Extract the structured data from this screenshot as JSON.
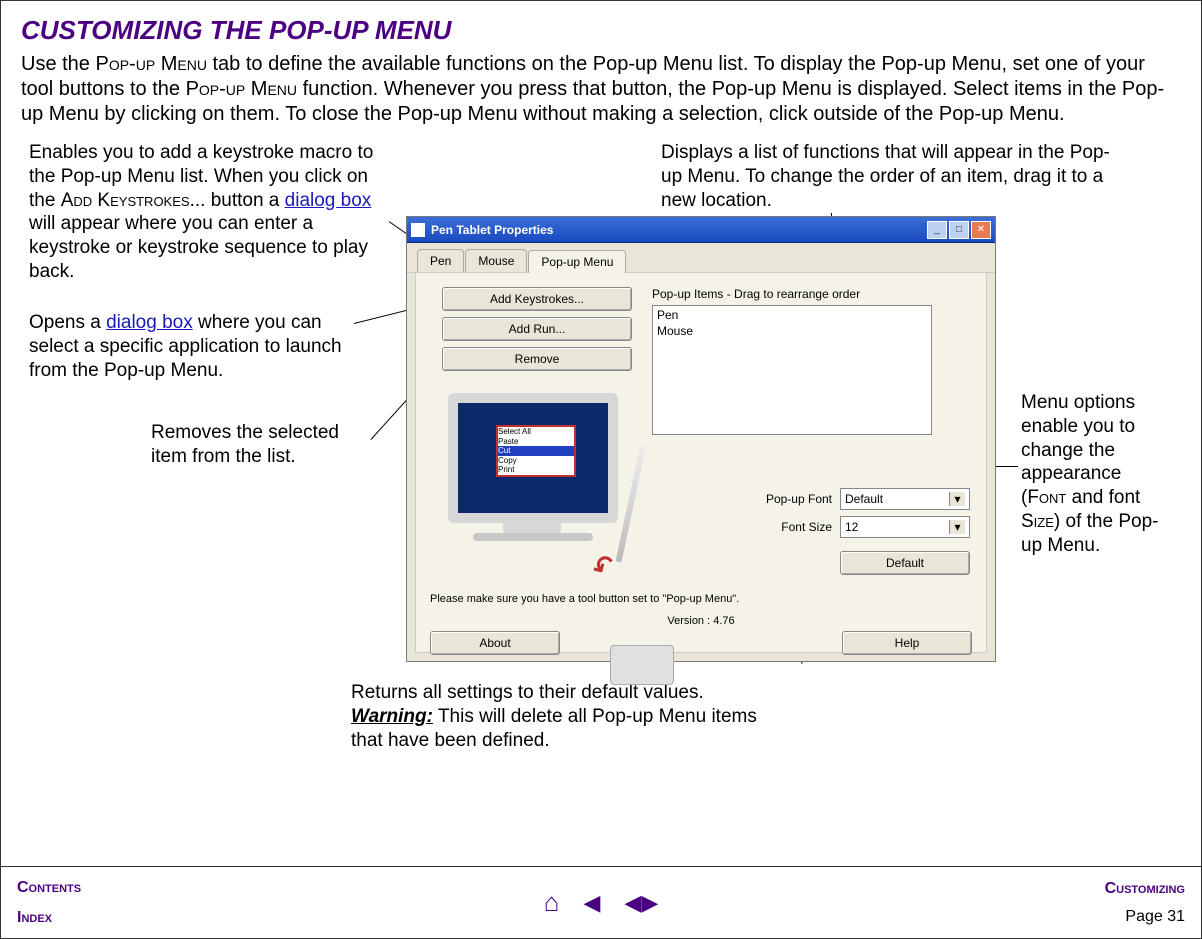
{
  "title": "CUSTOMIZING THE POP-UP MENU",
  "intro": "Use the Pop-up Menu tab to define the available functions on the Pop-up Menu list. To display the Pop-up Menu, set one of your tool buttons to the Pop-up Menu function. Whenever you press that button, the Pop-up Menu is displayed. Select items in the Pop-up Menu by clicking on them. To close the Pop-up Menu without making a selection, click outside of the Pop-up Menu.",
  "callouts": {
    "addKeystrokes": {
      "pre": "Enables you to add a keystroke macro to the Pop-up Menu list. When you click on the ",
      "sc": "Add Keystrokes",
      "mid": "... button a ",
      "link": "dialog box",
      "post": " will appear where you can enter a keystroke or keystroke sequence to play back."
    },
    "addRun": {
      "pre": "Opens a ",
      "link": "dialog box",
      "post": " where you can select a specific application to launch from the Pop-up Menu."
    },
    "remove": "Removes the selected item from the list.",
    "popupItems": "Displays a list of functions that will appear in the Pop-up Menu. To change the order of an item, drag it to a new location.",
    "fontOptions": {
      "pre": "Menu options enable you to change the appearance (",
      "sc1": "Font",
      "mid": " and font ",
      "sc2": "Size",
      "post": ") of the Pop-up Menu."
    },
    "default": {
      "line1": "Returns all settings to their default values.",
      "warnLabel": "Warning:",
      "warnText": " This will delete all Pop-up Menu items that have been defined."
    }
  },
  "window": {
    "title": "Pen Tablet Properties",
    "tabs": [
      "Pen",
      "Mouse",
      "Pop-up Menu"
    ],
    "activeTab": 2,
    "buttons": {
      "addKeystrokes": "Add Keystrokes...",
      "addRun": "Add Run...",
      "remove": "Remove",
      "default": "Default",
      "about": "About",
      "help": "Help"
    },
    "listLabel": "Pop-up Items - Drag to rearrange order",
    "listItems": [
      "Pen",
      "Mouse"
    ],
    "popupMenuItems": [
      "Select All",
      "Paste",
      "Cut",
      "Copy",
      "Print"
    ],
    "fontLabel": "Pop-up Font",
    "fontValue": "Default",
    "sizeLabel": "Font Size",
    "sizeValue": "12",
    "hint": "Please make sure you have a tool button set to \"Pop-up Menu\".",
    "version": "Version : 4.76"
  },
  "footer": {
    "contents": "Contents",
    "index": "Index",
    "section": "Customizing",
    "pageLabel": "Page ",
    "pageNum": "31"
  }
}
